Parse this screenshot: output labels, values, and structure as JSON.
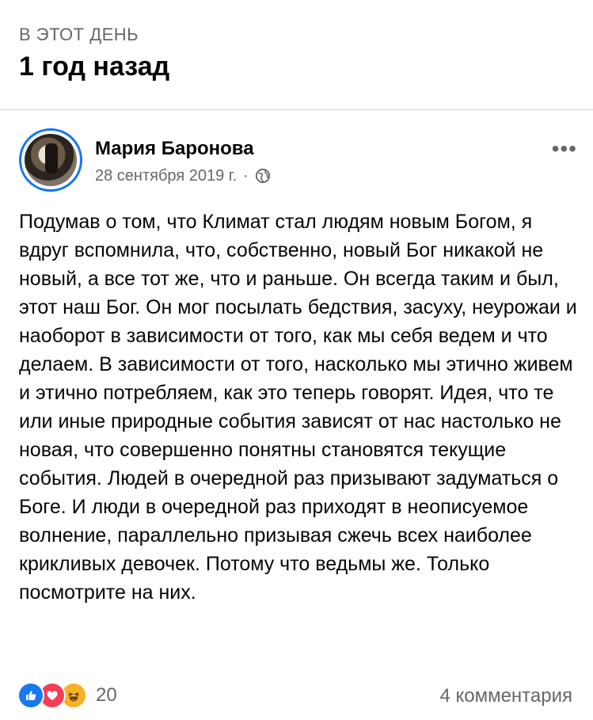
{
  "header": {
    "kicker": "В ЭТОТ ДЕНЬ",
    "title": "1 год назад"
  },
  "post": {
    "author": "Мария Баронова",
    "date": "28 сентября 2019 г.",
    "separator": "·",
    "privacy_icon": "globe-icon",
    "more_label": "•••",
    "text": "Подумав о том, что Климат стал людям новым Богом, я вдруг вспомнила, что, собственно, новый Бог никакой не новый, а все тот же, что и раньше. Он всегда таким и был, этот наш Бог. Он мог посылать бедствия, засуху, неурожаи и наоборот в зависимости от того, как мы себя ведем и что делаем. В зависимости от того, насколько мы этично живем и этично потребляем, как это теперь говорят. Идея, что те или иные природные события зависят от нас настолько не новая, что совершенно понятны становятся текущие события. Людей в очередной раз призывают задуматься о Боге. И люди в очередной раз приходят в неописуемое волнение, параллельно призывая сжечь всех наиболее крикливых девочек. Потому что ведьмы же. Только посмотрите на них."
  },
  "footer": {
    "reaction_icons": [
      "like-icon",
      "love-icon",
      "haha-icon"
    ],
    "reaction_count": "20",
    "comments_label": "4 комментария"
  },
  "colors": {
    "accent": "#1877f2",
    "secondary_text": "#65676b",
    "love": "#f33e58",
    "haha": "#f7b125"
  }
}
